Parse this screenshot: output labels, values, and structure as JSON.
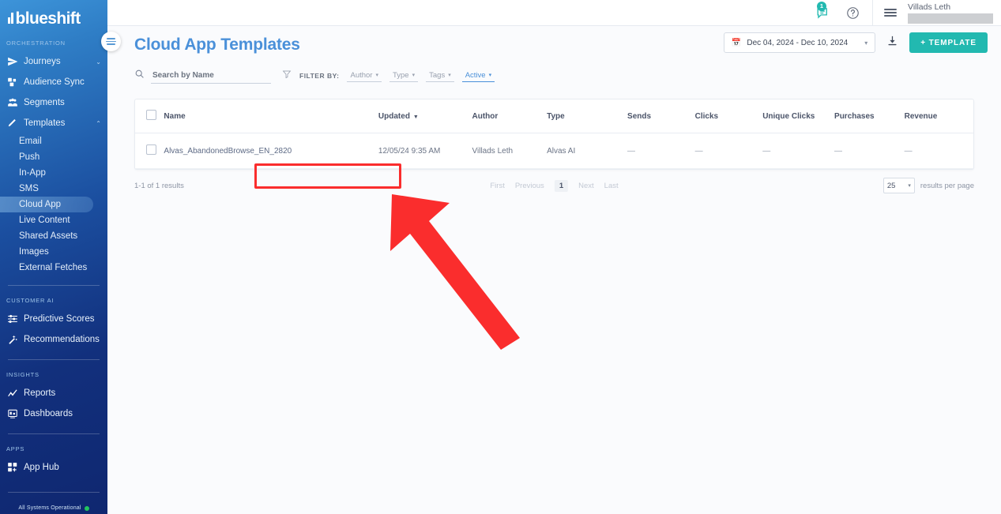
{
  "sidebar": {
    "logo": "blueshift",
    "sections": [
      {
        "label": "ORCHESTRATION",
        "items": [
          {
            "label": "Journeys",
            "icon": "send-icon",
            "caret": "⌄"
          },
          {
            "label": "Audience Sync",
            "icon": "audience-sync-icon"
          },
          {
            "label": "Segments",
            "icon": "segments-icon"
          },
          {
            "label": "Templates",
            "icon": "pencil-icon",
            "caret": "⌃"
          }
        ],
        "subitems": [
          {
            "label": "Email",
            "active": false
          },
          {
            "label": "Push",
            "active": false
          },
          {
            "label": "In-App",
            "active": false
          },
          {
            "label": "SMS",
            "active": false
          },
          {
            "label": "Cloud App",
            "active": true
          },
          {
            "label": "Live Content",
            "active": false
          },
          {
            "label": "Shared Assets",
            "active": false
          },
          {
            "label": "Images",
            "active": false
          },
          {
            "label": "External Fetches",
            "active": false
          }
        ]
      },
      {
        "label": "CUSTOMER AI",
        "items": [
          {
            "label": "Predictive Scores",
            "icon": "sliders-icon"
          },
          {
            "label": "Recommendations",
            "icon": "magic-wand-icon"
          }
        ]
      },
      {
        "label": "INSIGHTS",
        "items": [
          {
            "label": "Reports",
            "icon": "chart-line-icon"
          },
          {
            "label": "Dashboards",
            "icon": "dashboard-icon"
          }
        ]
      },
      {
        "label": "APPS",
        "items": [
          {
            "label": "App Hub",
            "icon": "app-grid-icon"
          }
        ]
      }
    ],
    "status": "All Systems Operational"
  },
  "topbar": {
    "chat_badge": "1",
    "help_icon": "?",
    "user_name": "Villads Leth"
  },
  "page": {
    "title": "Cloud App Templates"
  },
  "search": {
    "placeholder": "Search by Name",
    "value": ""
  },
  "filters": {
    "label": "FILTER BY:",
    "chips": [
      {
        "label": "Author",
        "active": false
      },
      {
        "label": "Type",
        "active": false
      },
      {
        "label": "Tags",
        "active": false
      },
      {
        "label": "Active",
        "active": true
      }
    ]
  },
  "actions": {
    "date_range": "Dec 04, 2024 - Dec 10, 2024",
    "download_icon": "download-icon",
    "new_template": "+ TEMPLATE"
  },
  "table": {
    "columns": [
      {
        "label": "Name",
        "sort": ""
      },
      {
        "label": "Updated",
        "sort": "▼"
      },
      {
        "label": "Author",
        "sort": ""
      },
      {
        "label": "Type",
        "sort": ""
      },
      {
        "label": "Sends",
        "sort": ""
      },
      {
        "label": "Clicks",
        "sort": ""
      },
      {
        "label": "Unique Clicks",
        "sort": ""
      },
      {
        "label": "Purchases",
        "sort": ""
      },
      {
        "label": "Revenue",
        "sort": ""
      }
    ],
    "rows": [
      {
        "name": "Alvas_AbandonedBrowse_EN_2820",
        "updated": "12/05/24 9:35 AM",
        "author": "Villads Leth",
        "type": "Alvas AI",
        "sends": "—",
        "clicks": "—",
        "unique_clicks": "—",
        "purchases": "—",
        "revenue": "—"
      }
    ]
  },
  "footer": {
    "results": "1-1 of 1 results",
    "pager": [
      "First",
      "Previous",
      "1",
      "Next",
      "Last"
    ],
    "per_page_value": "25",
    "per_page_label": "results per page"
  },
  "annotation": {
    "highlight_color": "#fa2d2d",
    "arrow_color": "#fa2d2d"
  }
}
